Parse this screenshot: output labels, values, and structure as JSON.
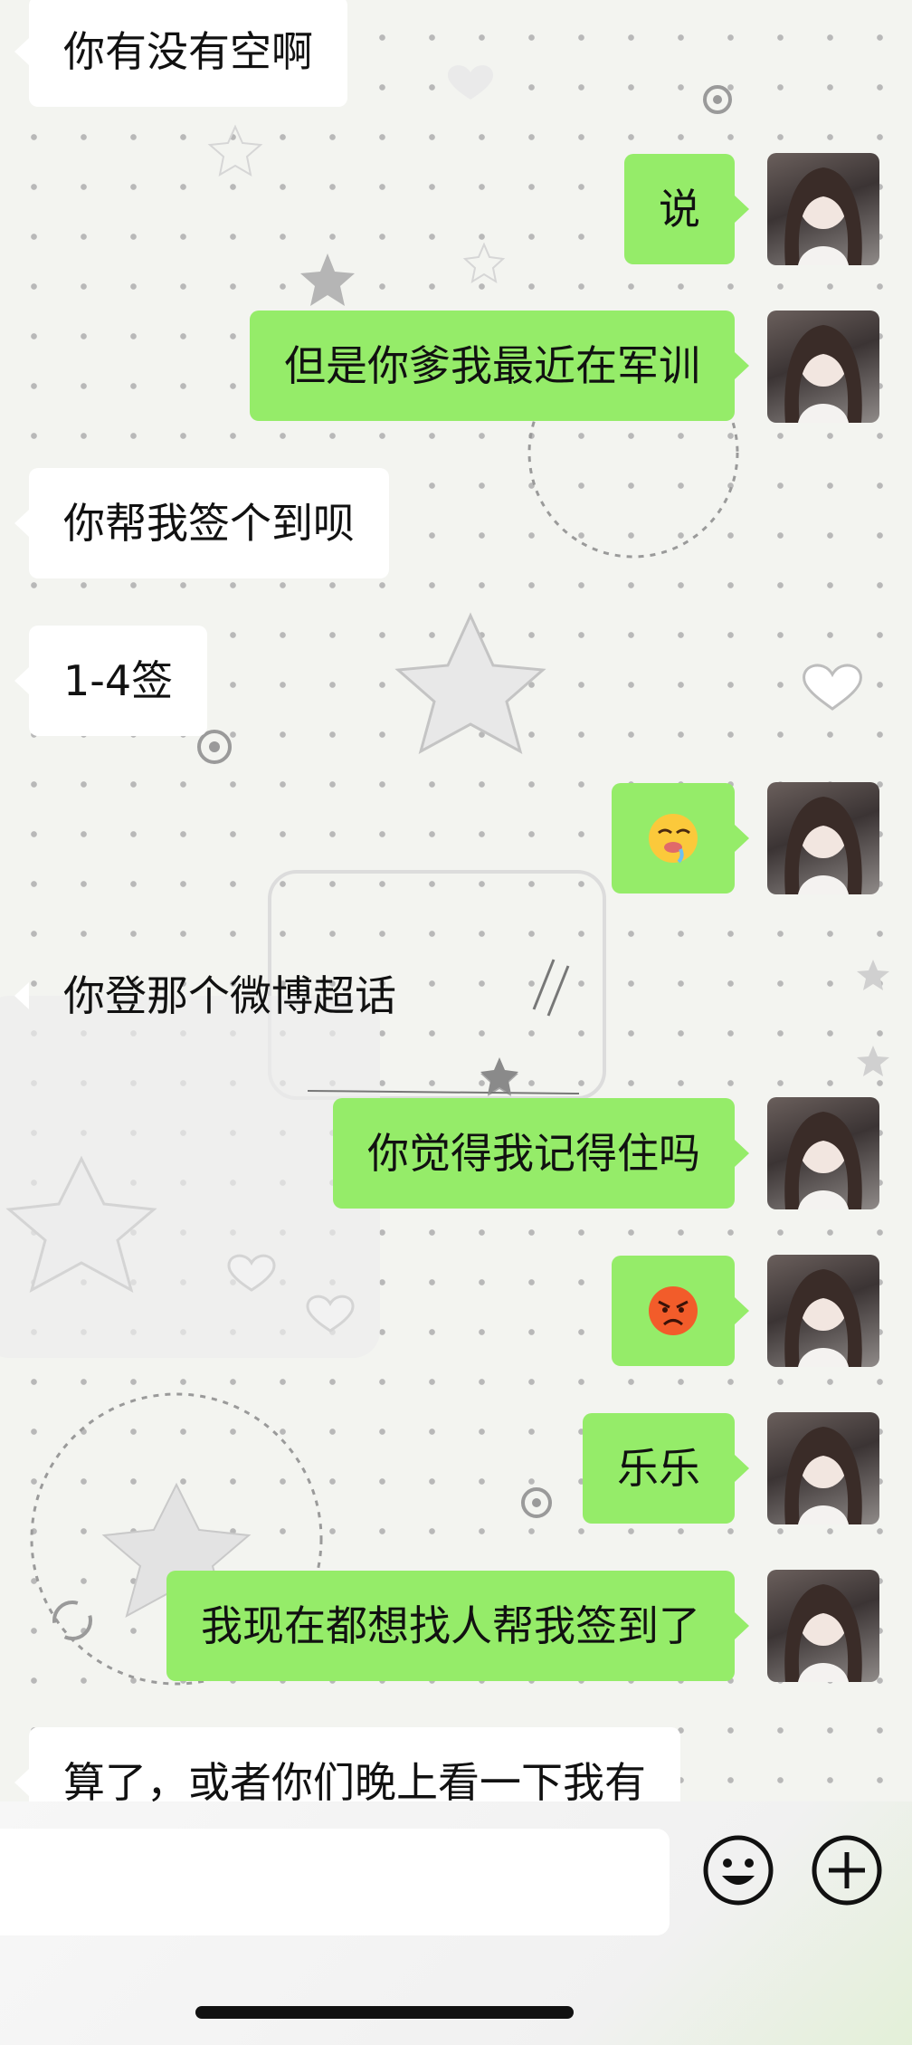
{
  "messages": [
    {
      "direction": "received",
      "text": "你有没有空啊"
    },
    {
      "direction": "sent",
      "text": "说"
    },
    {
      "direction": "sent",
      "text": "但是你爹我最近在军训"
    },
    {
      "direction": "received",
      "text": "你帮我签个到呗"
    },
    {
      "direction": "received",
      "text": "1-4签"
    },
    {
      "direction": "sent",
      "emoji": "drooling-face-emoji"
    },
    {
      "direction": "received",
      "text": "你登那个微博超话"
    },
    {
      "direction": "sent",
      "text": "你觉得我记得住吗"
    },
    {
      "direction": "sent",
      "emoji": "angry-face-emoji"
    },
    {
      "direction": "sent",
      "text": "乐乐"
    },
    {
      "direction": "sent",
      "text": "我现在都想找人帮我签到了"
    },
    {
      "direction": "received",
      "text": "算了，或者你们晚上看一下我有"
    }
  ],
  "input_bar": {
    "emoji_button_icon": "smiley-icon",
    "more_button_icon": "plus-icon"
  },
  "colors": {
    "sent_bubble": "#95ec69",
    "received_bubble": "#ffffff",
    "background": "#f3f4f0"
  }
}
